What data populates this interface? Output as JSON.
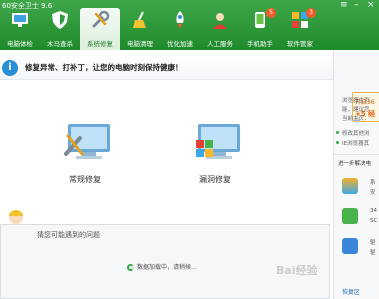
{
  "window": {
    "title": "60安全卫士 9.6"
  },
  "nav": [
    {
      "label": "电脑体检"
    },
    {
      "label": "木马查杀"
    },
    {
      "label": "系统修复"
    },
    {
      "label": "电脑清理"
    },
    {
      "label": "优化加速"
    },
    {
      "label": "人工服务"
    },
    {
      "label": "手机助手",
      "badge": "5"
    },
    {
      "label": "软件管家",
      "badge": "3"
    }
  ],
  "info": {
    "message": "修复异常、打补丁，让您的电脑时刻保持健康！"
  },
  "repair": {
    "regular_label": "常规修复",
    "vuln_label": "漏洞修复"
  },
  "problem": {
    "title": "猜您可能遇到的问题",
    "loading": "数据加载中，请稍候..."
  },
  "side": {
    "promo_line1": "开启36",
    "promo_line2": "+5 经",
    "browser1": "浏览器主页",
    "browser2": "能，建议您",
    "browser3": "当前主页：",
    "item1": "修改其他浏",
    "item2": "IE浏览器其",
    "section": "进一步解决电",
    "app1": "系",
    "app1b": "安",
    "app2": "34",
    "app2b": "SC",
    "app3": "驱",
    "app3b": "驱",
    "restore": "恢复区"
  },
  "watermark": "Bai经验"
}
